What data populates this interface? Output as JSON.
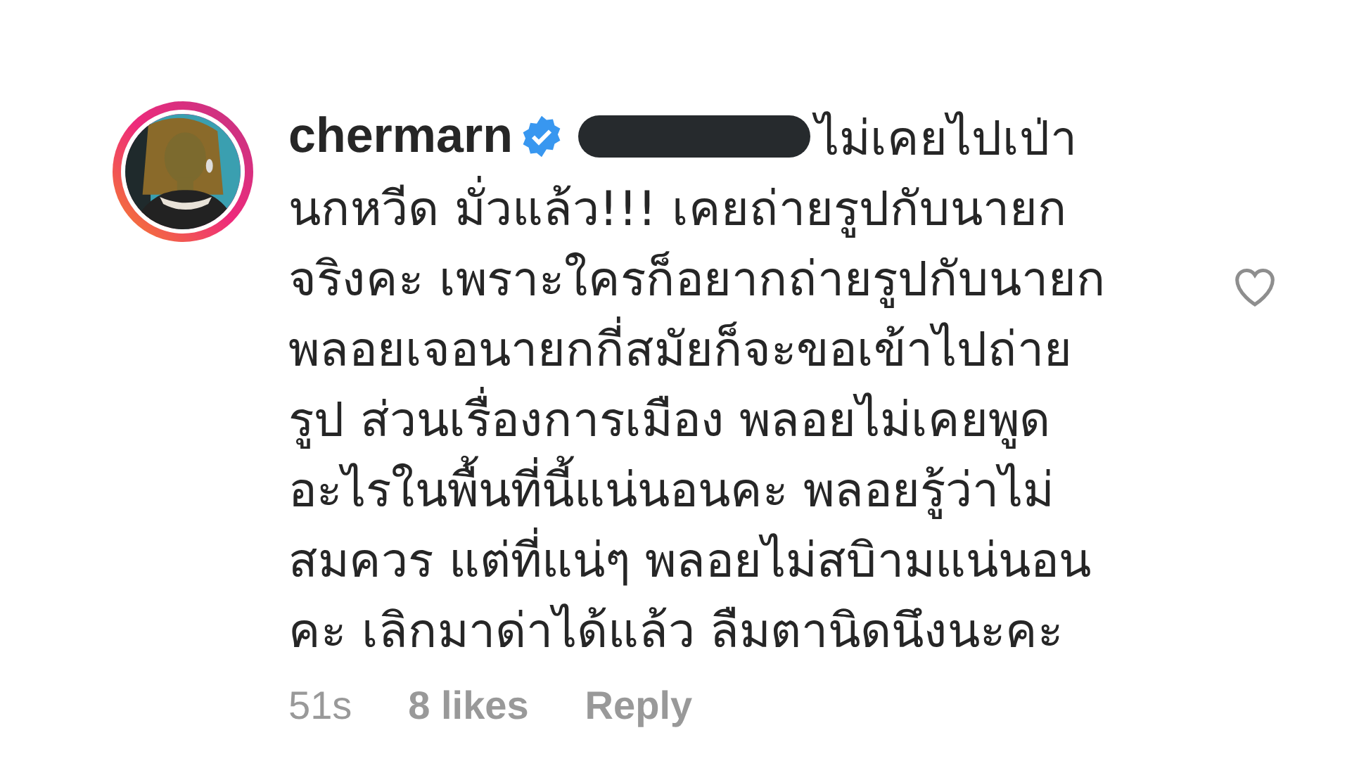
{
  "comment": {
    "avatar": {
      "kind": "picture",
      "story_ring": true
    },
    "username": "chermarn",
    "verified": true,
    "mention_redacted": true,
    "text_lines": [
      "ไม่เคยไปเป่า",
      "นกหวีด มั่วแล้ว!!! เคยถ่ายรูปกับนายก",
      "จริงคะ เพราะใครก็อยากถ่ายรูปกับนายก",
      "พลอยเจอนายกกี่สมัยก็จะขอเข้าไปถ่าย",
      "รูป ส่วนเรื่องการเมือง พลอยไม่เคยพูด",
      "อะไรในพื้นที่นี้แน่นอนคะ พลอยรู้ว่าไม่",
      "สมควร แต่ที่แน่ๆ พลอยไม่สบิามแน่นอน",
      "คะ เลิกมาด่าได้แล้ว ลืมตานิดนึงนะคะ"
    ],
    "time": "51s",
    "likes": "8 likes",
    "reply": "Reply",
    "liked": false
  }
}
